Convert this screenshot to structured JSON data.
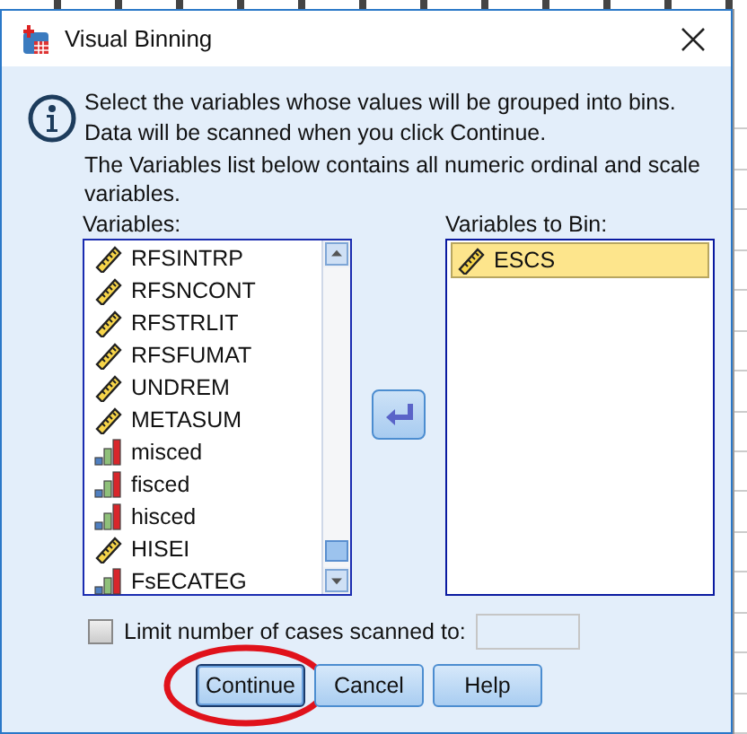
{
  "window": {
    "title": "Visual Binning"
  },
  "info": [
    "Select the variables whose values will be grouped into bins.",
    "Data will be scanned when you click Continue.",
    "The Variables list below contains all numeric ordinal and scale variables."
  ],
  "variables": {
    "label": "Variables:",
    "items": [
      {
        "name": "RFSINTRP",
        "kind": "scale",
        "selected": false
      },
      {
        "name": "RFSNCONT",
        "kind": "scale",
        "selected": false
      },
      {
        "name": "RFSTRLIT",
        "kind": "scale",
        "selected": false
      },
      {
        "name": "RFSFUMAT",
        "kind": "scale",
        "selected": false
      },
      {
        "name": "UNDREM",
        "kind": "scale",
        "selected": false
      },
      {
        "name": "METASUM",
        "kind": "scale",
        "selected": false
      },
      {
        "name": "misced",
        "kind": "ordinal",
        "selected": false
      },
      {
        "name": "fisced",
        "kind": "ordinal",
        "selected": false
      },
      {
        "name": "hisced",
        "kind": "ordinal",
        "selected": false
      },
      {
        "name": "HISEI",
        "kind": "scale",
        "selected": false
      },
      {
        "name": "FsECATEG",
        "kind": "ordinal",
        "selected": false
      }
    ]
  },
  "bin": {
    "label": "Variables to Bin:",
    "items": [
      {
        "name": "ESCS",
        "kind": "scale",
        "selected": true
      }
    ]
  },
  "limit": {
    "label": "Limit number of cases scanned to:",
    "checked": false,
    "disabled": true
  },
  "buttons": [
    {
      "label": "Continue",
      "focused": true,
      "circled": true
    },
    {
      "label": "Cancel",
      "focused": false,
      "circled": false
    },
    {
      "label": "Help",
      "focused": false,
      "circled": false
    }
  ]
}
